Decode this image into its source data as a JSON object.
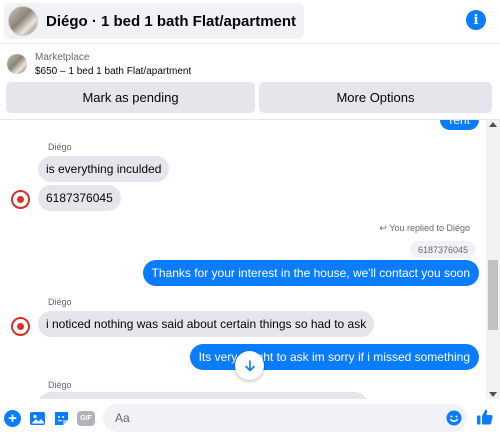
{
  "header": {
    "title": "Diégo · 1 bed 1 bath Flat/apartment",
    "thumbnail_icon": "listing-photo",
    "info_icon": "info-icon"
  },
  "marketplace": {
    "label": "Marketplace",
    "listing": "$650 – 1 bed 1 bath Flat/apartment",
    "mark_pending_label": "Mark as pending",
    "more_options_label": "More Options"
  },
  "messages": {
    "partial_top": "rent",
    "sender_1": "Diégo",
    "msg_1": "is everything inculded",
    "msg_2": "6187376045",
    "replied_note": "You replied to Diégo",
    "reply_quote": "6187376045",
    "msg_3": "Thanks for your interest in the house, we'll contact you soon",
    "sender_2": "Diégo",
    "msg_4": "i noticed nothing was said about certain things so had to ask",
    "msg_5": "Its very alright to ask im sorry if i missed something",
    "sender_3": "Diégo"
  },
  "composer": {
    "placeholder": "Aa"
  },
  "colors": {
    "accent": "#0a7cff",
    "incoming_bubble": "#e4e6eb",
    "avatar_red": "#d93025"
  }
}
